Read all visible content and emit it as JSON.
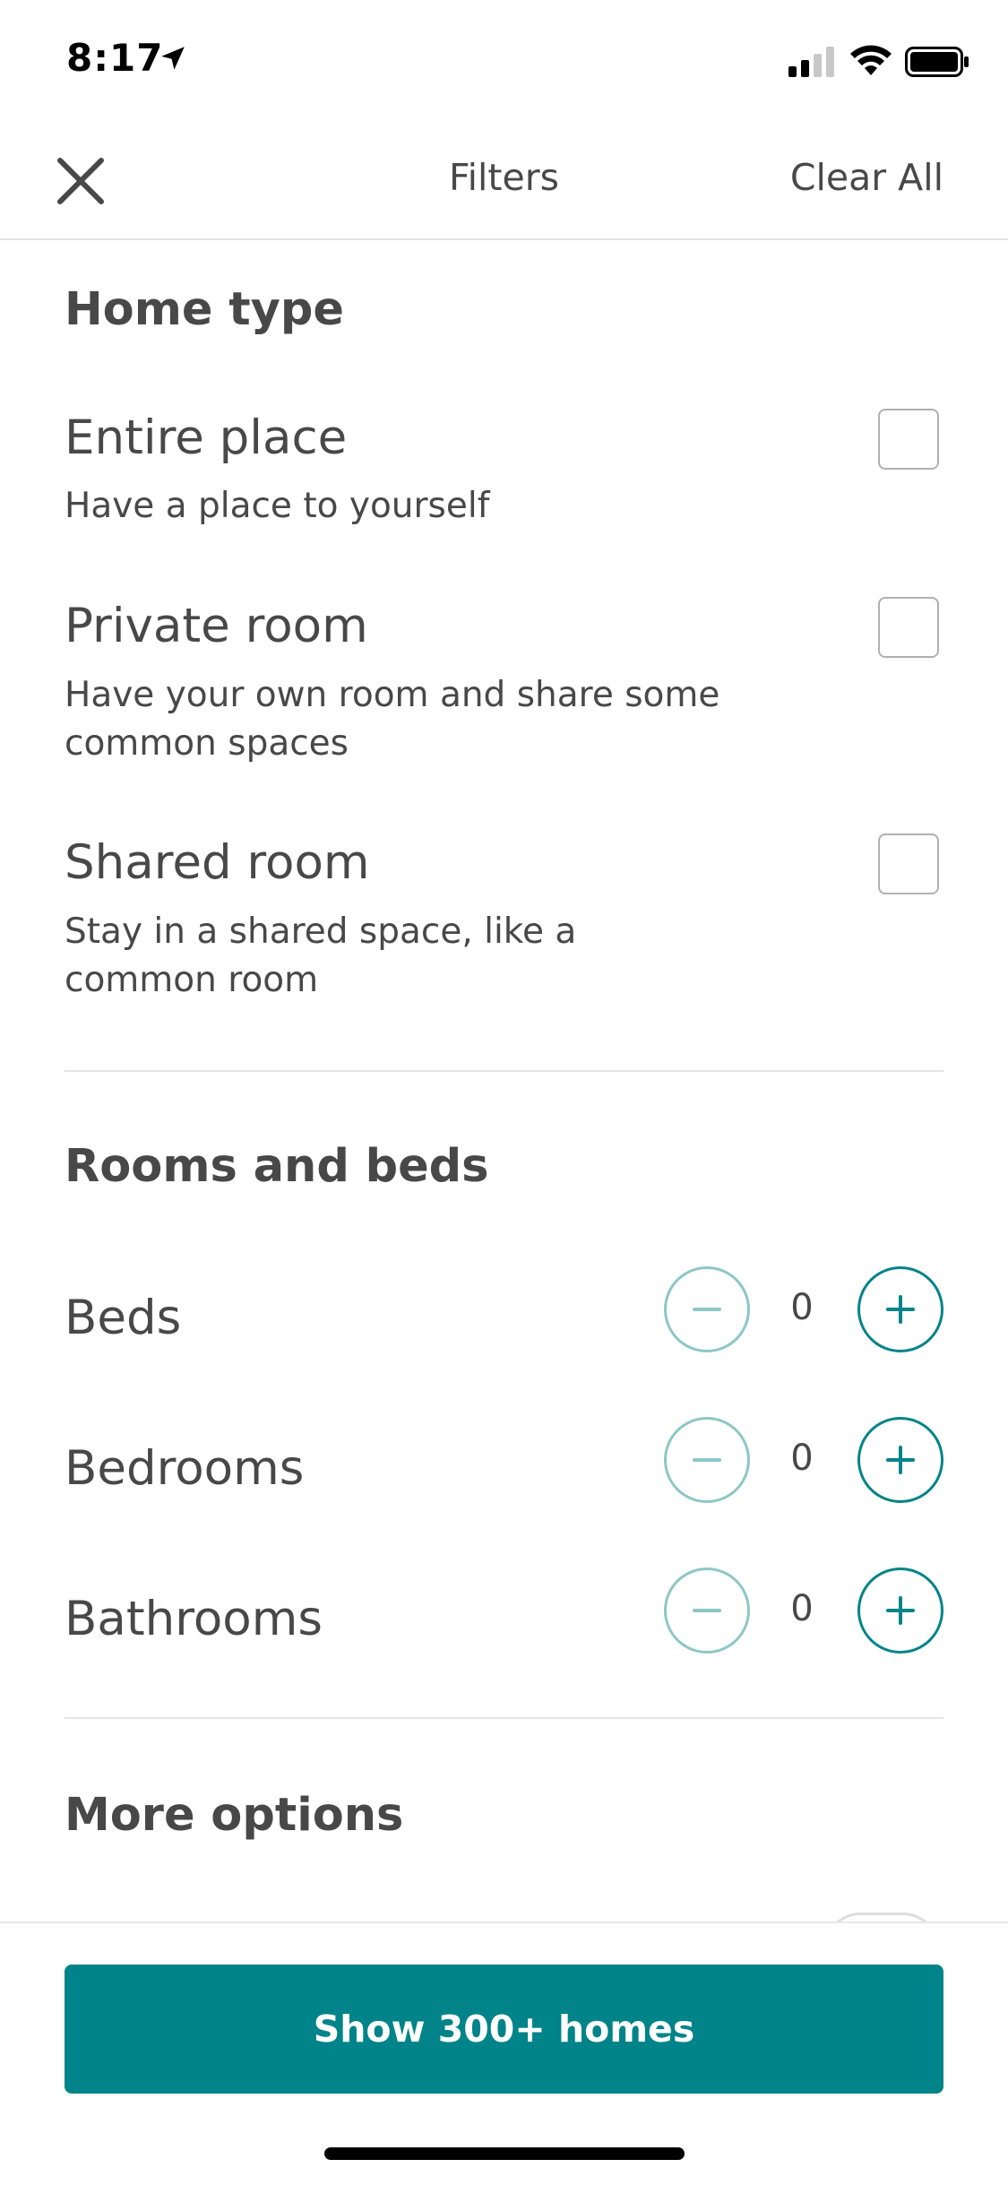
{
  "status_bar": {
    "time": "8:17"
  },
  "header": {
    "title": "Filters",
    "clear_label": "Clear All"
  },
  "home_type": {
    "title": "Home type",
    "options": [
      {
        "title": "Entire place",
        "description": "Have a place to yourself",
        "checked": false
      },
      {
        "title": "Private room",
        "description": "Have your own room and share some common spaces",
        "checked": false
      },
      {
        "title": "Shared room",
        "description": "Stay in a shared space, like a common room",
        "checked": false
      }
    ]
  },
  "rooms_and_beds": {
    "title": "Rooms and beds",
    "rows": [
      {
        "label": "Beds",
        "value": "0"
      },
      {
        "label": "Bedrooms",
        "value": "0"
      },
      {
        "label": "Bathrooms",
        "value": "0"
      }
    ]
  },
  "more_options": {
    "title": "More options"
  },
  "footer": {
    "button_label": "Show 300+ homes"
  },
  "colors": {
    "accent": "#008489",
    "accent_light": "#8cc7c5",
    "text": "#484848",
    "divider": "#e4e4e4"
  }
}
